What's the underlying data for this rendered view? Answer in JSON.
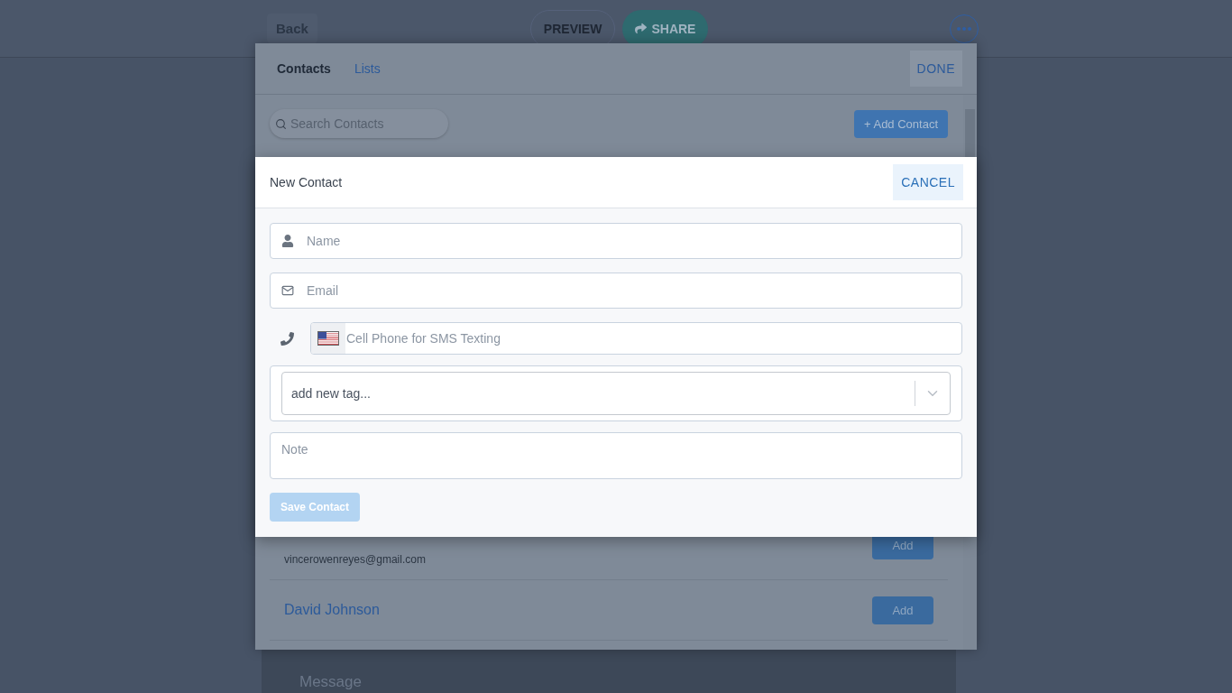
{
  "background_page": {
    "back": "Back",
    "preview": "PREVIEW",
    "share": "SHARE",
    "message_placeholder": "Message"
  },
  "contacts_dialog": {
    "tabs": [
      {
        "label": "Contacts",
        "selected": true
      },
      {
        "label": "Lists",
        "selected": false
      }
    ],
    "done": "DONE",
    "search": {
      "placeholder": "Search Contacts"
    },
    "add_contact": "+ Add Contact",
    "contacts": [
      {
        "email": "vincerowenreyes@gmail.com",
        "action": "Add"
      },
      {
        "name": "David Johnson",
        "action": "Add"
      }
    ]
  },
  "new_contact_dialog": {
    "title": "New Contact",
    "cancel": "CANCEL",
    "fields": [
      {
        "kind": "name",
        "placeholder": "Name"
      },
      {
        "kind": "email",
        "placeholder": "Email"
      },
      {
        "kind": "phone",
        "placeholder": "Cell Phone for SMS Texting"
      }
    ],
    "tag_select": {
      "placeholder": "add new tag..."
    },
    "note": {
      "placeholder": "Note"
    },
    "save": {
      "label": "Save Contact",
      "disabled": true
    }
  }
}
